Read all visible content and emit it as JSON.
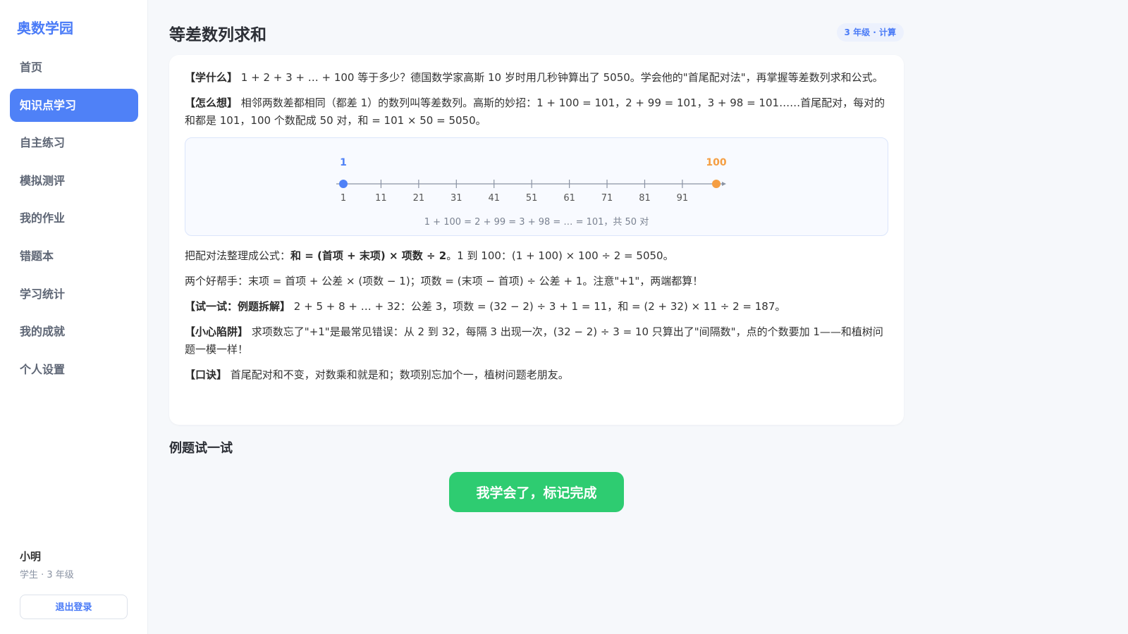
{
  "sidebar": {
    "brand": "奥数学园",
    "items": [
      {
        "label": "首页"
      },
      {
        "label": "知识点学习"
      },
      {
        "label": "自主练习"
      },
      {
        "label": "模拟测评"
      },
      {
        "label": "我的作业"
      },
      {
        "label": "错题本"
      },
      {
        "label": "学习统计"
      },
      {
        "label": "我的成就"
      },
      {
        "label": "个人设置"
      }
    ],
    "active_index": 1,
    "user": {
      "name": "小明",
      "role": "学生 · 3 年级"
    },
    "logout_label": "退出登录"
  },
  "lesson": {
    "title": "等差数列求和",
    "badge": "3 年级 · 计算",
    "what_tag": "【学什么】",
    "what_text": "1 + 2 + 3 + … + 100 等于多少？德国数学家高斯 10 岁时用几秒钟算出了 5050。学会他的\"首尾配对法\"，再掌握等差数列求和公式。",
    "how_tag": "【怎么想】",
    "how_text": "相邻两数差都相同（都差 1）的数列叫等差数列。高斯的妙招：1 + 100 = 101，2 + 99 = 101，3 + 98 = 101……首尾配对，每对的和都是 101，100 个数配成 50 对，和 = 101 × 50 = 5050。",
    "formula_prefix": "把配对法整理成公式：",
    "formula_bold": "和 = (首项 + 末项) × 项数 ÷ 2",
    "formula_suffix": "。1 到 100：(1 + 100) × 100 ÷ 2 = 5050。",
    "helpers_text": "两个好帮手：末项 = 首项 + 公差 × (项数 − 1)；项数 = (末项 − 首项) ÷ 公差 + 1。注意\"+1\"，两端都算！",
    "try_tag": "【试一试：例题拆解】",
    "try_text": "2 + 5 + 8 + … + 32：公差 3，项数 = (32 − 2) ÷ 3 + 1 = 11，和 = (2 + 32) × 11 ÷ 2 = 187。",
    "trap_tag": "【小心陷阱】",
    "trap_text": "求项数忘了\"+1\"是最常见错误：从 2 到 32，每隔 3 出现一次，(32 − 2) ÷ 3 = 10 只算出了\"间隔数\"，点的个数要加 1——和植树问题一模一样！",
    "rhyme_tag": "【口诀】",
    "rhyme_text": "首尾配对和不变，对数乘和就是和；数项别忘加个一，植树问题老朋友。"
  },
  "number_line": {
    "start_label": "1",
    "end_label": "100",
    "start_value": 1,
    "end_value": 100,
    "ticks": [
      "1",
      "11",
      "21",
      "31",
      "41",
      "51",
      "61",
      "71",
      "81",
      "91"
    ],
    "caption": "1 + 100 = 2 + 99 = 3 + 98 = … = 101，共 50 对",
    "start_color": "#4f81f7",
    "end_color": "#f59e42",
    "line_color": "#8a93a3"
  },
  "example_section_title": "例题试一试",
  "complete_button": "我学会了，标记完成"
}
